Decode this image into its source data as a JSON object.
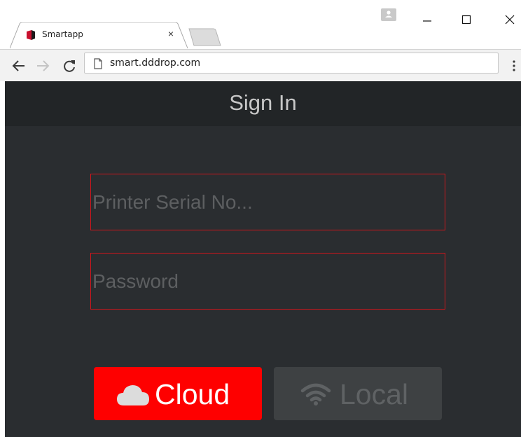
{
  "browser": {
    "tab": {
      "title": "Smartapp",
      "close_glyph": "×",
      "favicon": "smartapp-favicon"
    },
    "address_bar": {
      "url": "smart.dddrop.com",
      "page_icon": "page-icon"
    },
    "window_controls": {
      "minimize_icon": "minimize-icon",
      "maximize_icon": "maximize-icon",
      "close_icon": "close-icon"
    }
  },
  "app": {
    "header_title": "Sign In",
    "serial_field": {
      "placeholder": "Printer Serial No...",
      "value": ""
    },
    "password_field": {
      "placeholder": "Password",
      "value": ""
    },
    "buttons": {
      "cloud": {
        "label": "Cloud",
        "icon": "cloud-icon",
        "color": "#fe0000"
      },
      "local": {
        "label": "Local",
        "icon": "wifi-icon",
        "color": "#3e4143"
      }
    },
    "colors": {
      "background": "#2a2d30",
      "header": "#222527",
      "field_border": "#d0161c"
    }
  }
}
